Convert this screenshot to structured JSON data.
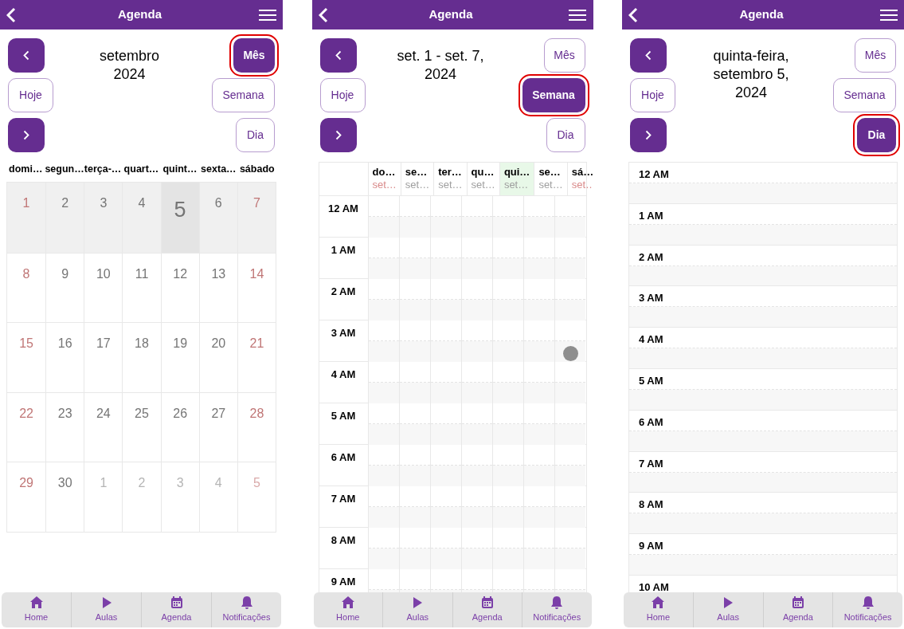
{
  "screens": [
    {
      "header": {
        "title": "Agenda"
      },
      "title": "setembro 2024",
      "today_button": "Hoje",
      "views": [
        {
          "label": "Mês",
          "selected": true
        },
        {
          "label": "Semana",
          "selected": false
        },
        {
          "label": "Dia",
          "selected": false
        }
      ],
      "calendar": {
        "kind": "month",
        "weekdays": [
          "domi…",
          "segun…",
          "terça-…",
          "quart…",
          "quint…",
          "sexta…",
          "sábado"
        ],
        "weeks": [
          {
            "current": true,
            "days": [
              {
                "label": "1",
                "weekend": true,
                "today": false,
                "outside": false
              },
              {
                "label": "2",
                "weekend": false,
                "today": false,
                "outside": false
              },
              {
                "label": "3",
                "weekend": false,
                "today": false,
                "outside": false
              },
              {
                "label": "4",
                "weekend": false,
                "today": false,
                "outside": false
              },
              {
                "label": "5",
                "weekend": false,
                "today": true,
                "outside": false
              },
              {
                "label": "6",
                "weekend": false,
                "today": false,
                "outside": false
              },
              {
                "label": "7",
                "weekend": true,
                "today": false,
                "outside": false
              }
            ]
          },
          {
            "current": false,
            "days": [
              {
                "label": "8",
                "weekend": true,
                "today": false,
                "outside": false
              },
              {
                "label": "9",
                "weekend": false,
                "today": false,
                "outside": false
              },
              {
                "label": "10",
                "weekend": false,
                "today": false,
                "outside": false
              },
              {
                "label": "11",
                "weekend": false,
                "today": false,
                "outside": false
              },
              {
                "label": "12",
                "weekend": false,
                "today": false,
                "outside": false
              },
              {
                "label": "13",
                "weekend": false,
                "today": false,
                "outside": false
              },
              {
                "label": "14",
                "weekend": true,
                "today": false,
                "outside": false
              }
            ]
          },
          {
            "current": false,
            "days": [
              {
                "label": "15",
                "weekend": true,
                "today": false,
                "outside": false
              },
              {
                "label": "16",
                "weekend": false,
                "today": false,
                "outside": false
              },
              {
                "label": "17",
                "weekend": false,
                "today": false,
                "outside": false
              },
              {
                "label": "18",
                "weekend": false,
                "today": false,
                "outside": false
              },
              {
                "label": "19",
                "weekend": false,
                "today": false,
                "outside": false
              },
              {
                "label": "20",
                "weekend": false,
                "today": false,
                "outside": false
              },
              {
                "label": "21",
                "weekend": true,
                "today": false,
                "outside": false
              }
            ]
          },
          {
            "current": false,
            "days": [
              {
                "label": "22",
                "weekend": true,
                "today": false,
                "outside": false
              },
              {
                "label": "23",
                "weekend": false,
                "today": false,
                "outside": false
              },
              {
                "label": "24",
                "weekend": false,
                "today": false,
                "outside": false
              },
              {
                "label": "25",
                "weekend": false,
                "today": false,
                "outside": false
              },
              {
                "label": "26",
                "weekend": false,
                "today": false,
                "outside": false
              },
              {
                "label": "27",
                "weekend": false,
                "today": false,
                "outside": false
              },
              {
                "label": "28",
                "weekend": true,
                "today": false,
                "outside": false
              }
            ]
          },
          {
            "current": false,
            "days": [
              {
                "label": "29",
                "weekend": true,
                "today": false,
                "outside": false
              },
              {
                "label": "30",
                "weekend": false,
                "today": false,
                "outside": false
              },
              {
                "label": "1",
                "weekend": false,
                "today": false,
                "outside": true
              },
              {
                "label": "2",
                "weekend": false,
                "today": false,
                "outside": true
              },
              {
                "label": "3",
                "weekend": false,
                "today": false,
                "outside": true
              },
              {
                "label": "4",
                "weekend": false,
                "today": false,
                "outside": true
              },
              {
                "label": "5",
                "weekend": true,
                "today": false,
                "outside": true
              }
            ]
          }
        ]
      },
      "nav": [
        {
          "label": "Home"
        },
        {
          "label": "Aulas"
        },
        {
          "label": "Agenda"
        },
        {
          "label": "Notificações"
        }
      ]
    },
    {
      "header": {
        "title": "Agenda"
      },
      "title": "set. 1 - set. 7, 2024",
      "today_button": "Hoje",
      "views": [
        {
          "label": "Mês",
          "selected": false
        },
        {
          "label": "Semana",
          "selected": true
        },
        {
          "label": "Dia",
          "selected": false
        }
      ],
      "calendar": {
        "kind": "week",
        "days": [
          {
            "name": "do…",
            "date": "set…",
            "weekend": true,
            "today": false
          },
          {
            "name": "se…",
            "date": "set…",
            "weekend": false,
            "today": false
          },
          {
            "name": "ter…",
            "date": "set…",
            "weekend": false,
            "today": false
          },
          {
            "name": "qu…",
            "date": "set…",
            "weekend": false,
            "today": false
          },
          {
            "name": "qui…",
            "date": "set…",
            "weekend": false,
            "today": true
          },
          {
            "name": "se…",
            "date": "set…",
            "weekend": false,
            "today": false
          },
          {
            "name": "sá…",
            "date": "set…",
            "weekend": true,
            "today": false
          }
        ],
        "hours": [
          "12 AM",
          "1 AM",
          "2 AM",
          "3 AM",
          "4 AM",
          "5 AM",
          "6 AM",
          "7 AM",
          "8 AM",
          "9 AM"
        ]
      },
      "nav": [
        {
          "label": "Home"
        },
        {
          "label": "Aulas"
        },
        {
          "label": "Agenda"
        },
        {
          "label": "Notificações"
        }
      ]
    },
    {
      "header": {
        "title": "Agenda"
      },
      "title": "quinta-feira, setembro 5, 2024",
      "today_button": "Hoje",
      "views": [
        {
          "label": "Mês",
          "selected": false
        },
        {
          "label": "Semana",
          "selected": false
        },
        {
          "label": "Dia",
          "selected": true
        }
      ],
      "calendar": {
        "kind": "day",
        "hours": [
          "12 AM",
          "1 AM",
          "2 AM",
          "3 AM",
          "4 AM",
          "5 AM",
          "6 AM",
          "7 AM",
          "8 AM",
          "9 AM",
          "10 AM"
        ]
      },
      "nav": [
        {
          "label": "Home"
        },
        {
          "label": "Aulas"
        },
        {
          "label": "Agenda"
        },
        {
          "label": "Notificações"
        }
      ]
    }
  ]
}
